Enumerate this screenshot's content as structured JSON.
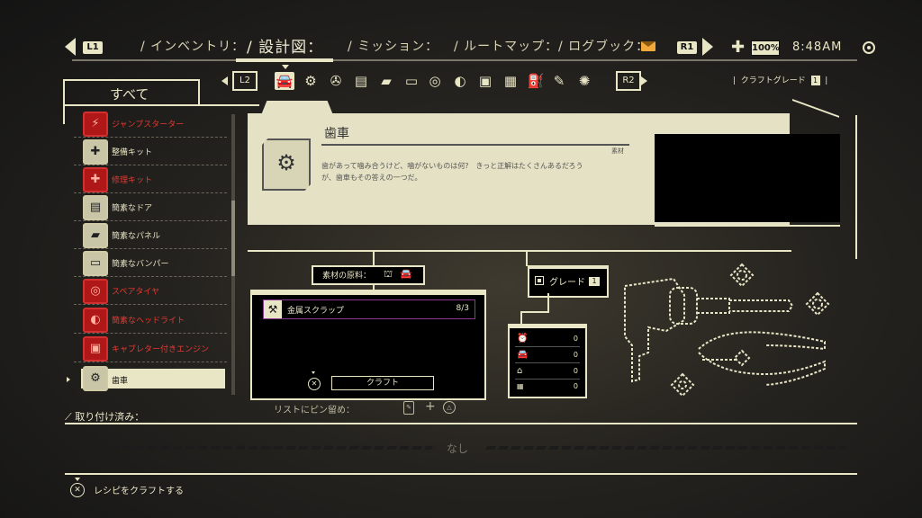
{
  "topbar": {
    "l1": "L1",
    "r1": "R1",
    "tabs": [
      {
        "label": "インベントリ：",
        "active": false
      },
      {
        "label": "設計図：",
        "active": true
      },
      {
        "label": "ミッション：",
        "active": false
      },
      {
        "label": "ルートマップ：",
        "active": false
      },
      {
        "label": "ログブック：",
        "active": false
      }
    ],
    "health": "100%",
    "time": "8:48AM"
  },
  "categories": {
    "l2": "L2",
    "r2": "R2",
    "icons": [
      "car-icon",
      "gears-icon",
      "tools-icon",
      "door-icon",
      "panel-icon",
      "bumper-icon",
      "tire-icon",
      "headlight-icon",
      "engine-icon",
      "battery-icon",
      "fuel-icon",
      "spray-icon",
      "settings-icon"
    ],
    "craft_grade_label": "クラフトグレード",
    "craft_grade_value": "1"
  },
  "sidebar": {
    "title": "すべて",
    "items": [
      {
        "label": "ジャンプスターター",
        "red": true
      },
      {
        "label": "整備キット",
        "red": false
      },
      {
        "label": "修理キット",
        "red": true
      },
      {
        "label": "簡素なドア",
        "red": false
      },
      {
        "label": "簡素なパネル",
        "red": false
      },
      {
        "label": "簡素なバンパー",
        "red": false
      },
      {
        "label": "スペアタイヤ",
        "red": true
      },
      {
        "label": "簡素なヘッドライト",
        "red": true
      },
      {
        "label": "キャブレター付きエンジン",
        "red": true
      },
      {
        "label": "歯車",
        "red": false,
        "selected": true
      }
    ]
  },
  "detail": {
    "title": "歯車",
    "category": "素材",
    "description_line1": "歯があって噛み合うけど、噛がないものは何?　きっと正解はたくさんあるだろう",
    "description_line2": "が、歯車もその答えの一つだ。"
  },
  "materials": {
    "label": "素材の原料：",
    "rows": [
      {
        "name": "金属スクラップ",
        "count": "8/3"
      }
    ],
    "craft_button": "クラフト"
  },
  "grade": {
    "label": "グレード",
    "value": "1"
  },
  "stats": [
    {
      "icon": "alarm-icon",
      "value": "0"
    },
    {
      "icon": "car-icon",
      "value": "0"
    },
    {
      "icon": "garage-icon",
      "value": "0"
    },
    {
      "icon": "grid-icon",
      "value": "0"
    }
  ],
  "pin": {
    "label": "リストにピン留め："
  },
  "installed": {
    "label": "取り付け済み：",
    "none": "なし"
  },
  "footer": {
    "action": "レシピをクラフトする"
  },
  "colors": {
    "cream": "#e9e6c6",
    "red": "#e63a32",
    "purple": "#8a3a8f",
    "orange": "#f0a93a"
  }
}
